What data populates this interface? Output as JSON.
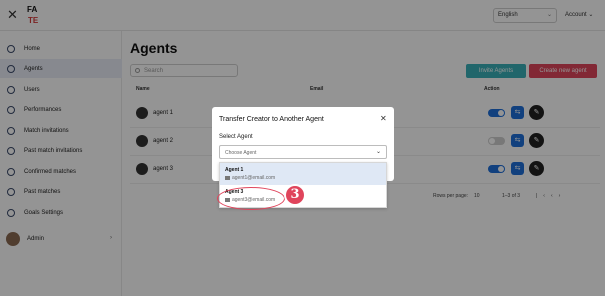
{
  "topbar": {
    "logo_text": "FA TE",
    "language": "English",
    "account": "Account"
  },
  "sidebar": {
    "items": [
      {
        "label": "Home"
      },
      {
        "label": "Agents"
      },
      {
        "label": "Users"
      },
      {
        "label": "Performances"
      },
      {
        "label": "Match invitations"
      },
      {
        "label": "Past match invitations"
      },
      {
        "label": "Confirmed matches"
      },
      {
        "label": "Past matches"
      },
      {
        "label": "Goals Settings"
      }
    ],
    "admin_label": "Admin"
  },
  "main": {
    "title": "Agents",
    "search_placeholder": "Search",
    "invite_button": "Invite Agents",
    "create_button": "Create new agent",
    "columns": {
      "name": "Name",
      "email": "Email",
      "action": "Action"
    },
    "rows": [
      {
        "name": "agent 1",
        "enabled": true
      },
      {
        "name": "agent 2",
        "enabled": false
      },
      {
        "name": "agent 3",
        "enabled": true
      }
    ],
    "footer": {
      "rows_per_page_label": "Rows per page:",
      "rows_per_page_value": "10",
      "range": "1–3 of 3"
    }
  },
  "modal": {
    "title": "Transfer Creator to Another Agent",
    "field_label": "Select Agent",
    "select_placeholder": "Choose Agent",
    "options": [
      {
        "name": "Agent 1",
        "email": "agent1@email.com"
      },
      {
        "name": "Agent 3",
        "email": "agent3@email.com"
      }
    ]
  },
  "annotation": {
    "step": "3"
  },
  "colors": {
    "accent_blue": "#1e6fd9",
    "invite_teal": "#3ab0b8",
    "create_red": "#e0455c",
    "highlight_option": "#dfe8f5"
  }
}
